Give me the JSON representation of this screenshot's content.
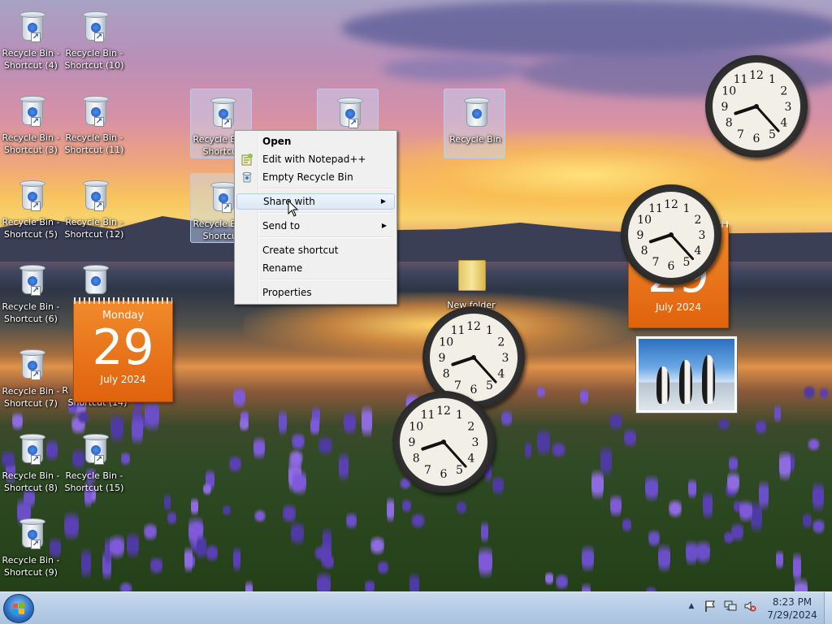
{
  "desktop": {
    "icons": [
      {
        "label": "Recycle Bin - Shortcut (4)",
        "shortcut": true
      },
      {
        "label": "Recycle Bin - Shortcut (10)",
        "shortcut": true
      },
      {
        "label": "Recycle Bin - Shortcut (3)",
        "shortcut": true
      },
      {
        "label": "Recycle Bin - Shortcut (11)",
        "shortcut": true
      },
      {
        "label": "Recycle Bin - Shortcut (5)",
        "shortcut": true
      },
      {
        "label": "Recycle Bin - Shortcut (12)",
        "shortcut": true
      },
      {
        "label": "Recycle Bin - Shortcut (6)",
        "shortcut": true
      },
      {
        "label": "Recycle Bin - Shortcut (7)",
        "shortcut": true
      },
      {
        "label": "Recycle Bin - Shortcut (8)",
        "shortcut": true
      },
      {
        "label": "Recycle Bin - Shortcut (15)",
        "shortcut": true
      },
      {
        "label": "Recycle Bin - Shortcut (9)",
        "shortcut": true
      },
      {
        "label": "Recycle Bin - Shortcut",
        "shortcut": true,
        "selected": true
      },
      {
        "label": "Recycle Bin - Shortcut",
        "shortcut": true,
        "selected": true
      },
      {
        "label": "Recycle Bin - Shortcut",
        "shortcut": true,
        "selected": true
      },
      {
        "label": "Recycle Bin",
        "shortcut": false,
        "selected": true
      }
    ],
    "partial_labels": {
      "behind_calendar": "Shortcut (14)",
      "behind_calendar_r": "R",
      "folder": "New folder"
    }
  },
  "context_menu": {
    "items": [
      {
        "label": "Open",
        "bold": true
      },
      {
        "label": "Edit with Notepad++",
        "icon": "notepad-plus-plus-icon"
      },
      {
        "label": "Empty Recycle Bin",
        "icon": "recycle-bin-small-icon"
      },
      {
        "label": "Share with",
        "submenu": true,
        "hovered": true
      },
      {
        "label": "Send to",
        "submenu": true
      },
      {
        "label": "Create shortcut"
      },
      {
        "label": "Rename"
      },
      {
        "label": "Properties"
      }
    ]
  },
  "calendar_left": {
    "weekday": "Monday",
    "day": "29",
    "month_year": "July 2024"
  },
  "calendar_right": {
    "day": "29",
    "month_year": "July 2024"
  },
  "clock_numbers": [
    "12",
    "1",
    "2",
    "3",
    "4",
    "5",
    "6",
    "7",
    "8",
    "9",
    "10",
    "11"
  ],
  "clocks_time": {
    "hour": 8,
    "minute": 23
  },
  "taskbar": {
    "time": "8:23 PM",
    "date": "7/29/2024",
    "tray_icons": [
      "show-hidden-icons-arrow",
      "action-center-flag-icon",
      "network-icon",
      "volume-muted-icon"
    ]
  },
  "colors": {
    "calendar_orange": "#e8701a",
    "taskbar": "#b7cde6",
    "menu_hover": "#dce8f7"
  }
}
